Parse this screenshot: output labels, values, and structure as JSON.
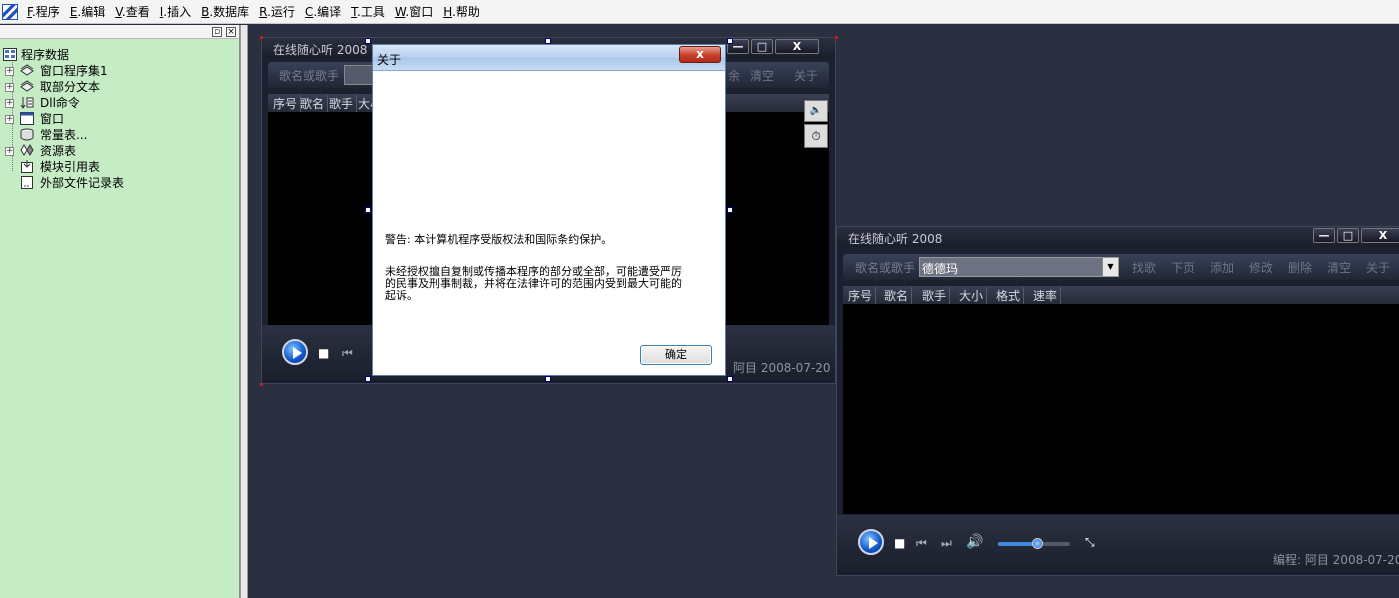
{
  "menu": [
    {
      "key": "F",
      "label": ".程序"
    },
    {
      "key": "E",
      "label": ".编辑"
    },
    {
      "key": "V",
      "label": ".查看"
    },
    {
      "key": "I",
      "label": ".插入"
    },
    {
      "key": "B",
      "label": ".数据库"
    },
    {
      "key": "R",
      "label": ".运行"
    },
    {
      "key": "C",
      "label": ".编译"
    },
    {
      "key": "T",
      "label": ".工具"
    },
    {
      "key": "W",
      "label": ".窗口"
    },
    {
      "key": "H",
      "label": ".帮助"
    }
  ],
  "left_panel": {
    "pin_glyph": "▫",
    "close_glyph": "×",
    "expand_glyph": "+",
    "tree_root": "程序数据",
    "tree_items": [
      {
        "label": "窗口程序集1",
        "icon": "module-icon"
      },
      {
        "label": "取部分文本",
        "icon": "module-icon"
      },
      {
        "label": "Dll命令",
        "icon": "dll-icon"
      },
      {
        "label": "窗口",
        "icon": "window-icon"
      },
      {
        "label": "常量表...",
        "icon": "constant-icon"
      },
      {
        "label": "资源表",
        "icon": "resource-icon"
      },
      {
        "label": "模块引用表",
        "icon": "module-ref-icon"
      },
      {
        "label": "外部文件记录表",
        "icon": "file-record-icon"
      }
    ]
  },
  "designer_player": {
    "title": "在线随心听 2008",
    "search_label": "歌名或歌手",
    "buttons_visible": [
      "余",
      "清空",
      "关于"
    ],
    "columns": [
      "序号",
      "歌名",
      "歌手",
      "大小"
    ],
    "credit": "阿目 2008-07-20",
    "window_buttons": [
      "—",
      "□",
      "X"
    ]
  },
  "about_dialog": {
    "title": "关于",
    "close_label": "x",
    "warning": "警告: 本计算机程序受版权法和国际条约保护。",
    "notice_line1": "未经授权擅自复制或传播本程序的部分或全部，可能遭受严厉",
    "notice_line2": "的民事及刑事制裁，并将在法律许可的范围内受到最大可能的",
    "notice_line3": "起诉。",
    "ok_label": "确定"
  },
  "running_player": {
    "title": "在线随心听 2008",
    "search_label": "歌名或歌手",
    "search_value": "德德玛",
    "buttons": [
      "找歌",
      "下页",
      "添加",
      "修改",
      "删除",
      "清空",
      "关于"
    ],
    "columns": [
      "序号",
      "歌名",
      "歌手",
      "大小",
      "格式",
      "速率"
    ],
    "credit": "编程: 阿目 2008-07-20",
    "window_buttons": [
      "—",
      "□",
      "X"
    ],
    "volume_level": 0.55
  }
}
